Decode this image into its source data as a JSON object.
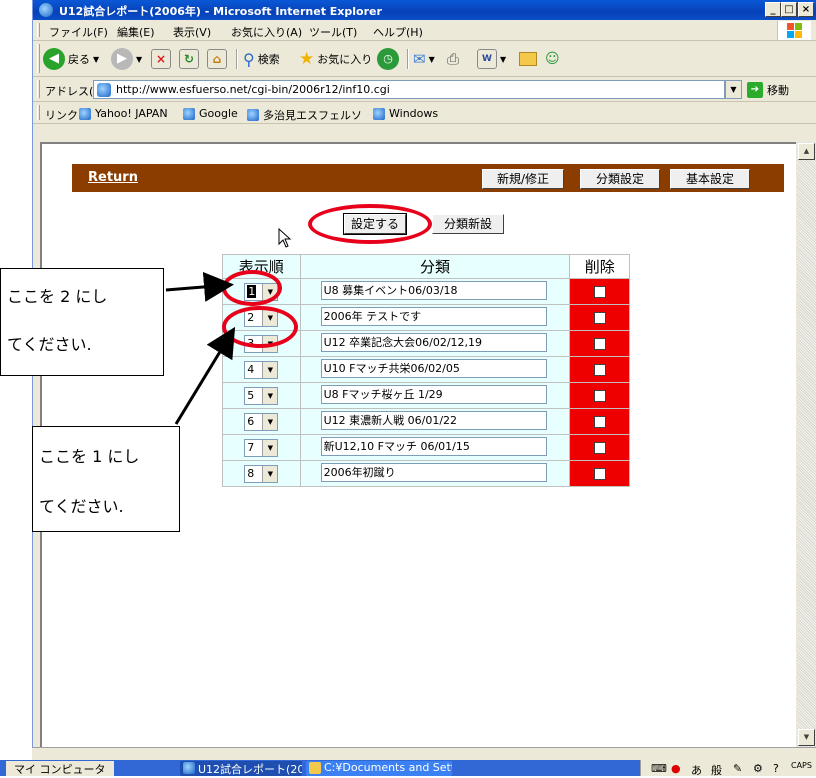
{
  "window": {
    "title": "U12試合レポート(2006年) - Microsoft Internet Explorer",
    "controls": {
      "minimize": "_",
      "maximize": "□",
      "close": "×"
    }
  },
  "menubar": {
    "items": [
      {
        "label": "ファイル(F)"
      },
      {
        "label": "編集(E)"
      },
      {
        "label": "表示(V)"
      },
      {
        "label": "お気に入り(A)"
      },
      {
        "label": "ツール(T)"
      },
      {
        "label": "ヘルプ(H)"
      }
    ]
  },
  "toolbar": {
    "back_label": "戻る",
    "search_label": "検索",
    "favorites_label": "お気に入り"
  },
  "addressbar": {
    "label": "アドレス(D)",
    "url": "http://www.esfuerso.net/cgi-bin/2006r12/inf10.cgi",
    "go_label": "移動"
  },
  "linksbar": {
    "label": "リンク",
    "links": [
      {
        "label": "Yahoo! JAPAN"
      },
      {
        "label": "Google"
      },
      {
        "label": "多治見エスフェルソ"
      },
      {
        "label": "Windows"
      }
    ]
  },
  "page": {
    "nav": {
      "return_label": "Return",
      "buttons": [
        {
          "label": "新規/修正"
        },
        {
          "label": "分類設定"
        },
        {
          "label": "基本設定"
        }
      ]
    },
    "settei_label": "設定する",
    "new_category_label": "分類新設",
    "table": {
      "headers": {
        "order": "表示順",
        "category": "分類",
        "delete": "削除"
      },
      "rows": [
        {
          "order": "1",
          "name": "U8 募集イベント06/03/18"
        },
        {
          "order": "2",
          "name": "2006年 テストです"
        },
        {
          "order": "3",
          "name": "U12 卒業記念大会06/02/12,19"
        },
        {
          "order": "4",
          "name": "U10 Fマッチ共栄06/02/05"
        },
        {
          "order": "5",
          "name": "U8 Fマッチ桜ヶ丘 1/29"
        },
        {
          "order": "6",
          "name": "U12 東濃新人戦 06/01/22"
        },
        {
          "order": "7",
          "name": "新U12,10 Fマッチ 06/01/15"
        },
        {
          "order": "8",
          "name": "2006年初蹴り"
        }
      ]
    }
  },
  "annotations": {
    "note1": {
      "line1": "ここを 2 にし",
      "line2": "てください."
    },
    "note2": {
      "line1": "ここを 1 にし",
      "line2": "てください."
    },
    "accent_color": "#e8001a"
  },
  "taskbar": {
    "my_computer": "マイ コンピュータ",
    "tasks": [
      {
        "label": "U12試合レポート(20..."
      },
      {
        "label": "C:¥Documents and Sett..."
      }
    ],
    "caps": "CAPS"
  }
}
